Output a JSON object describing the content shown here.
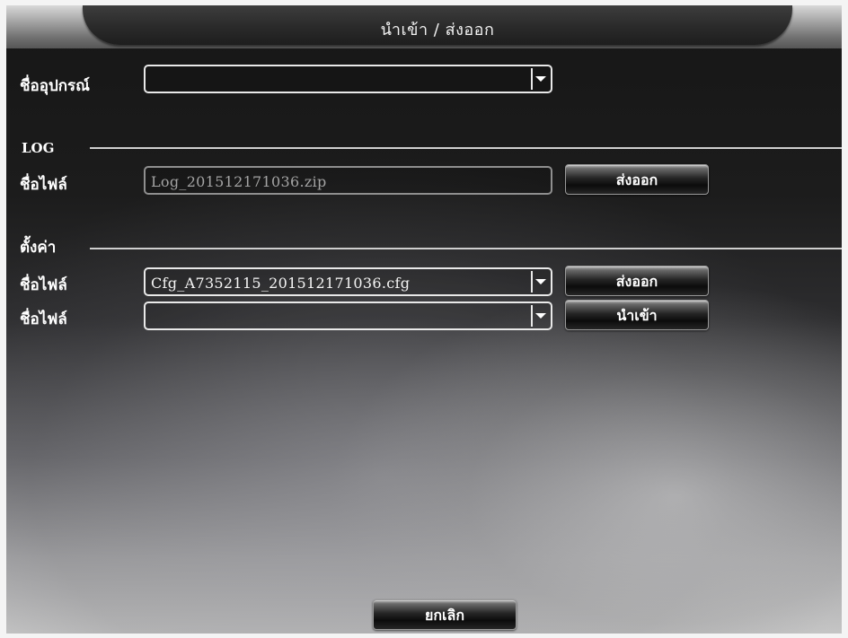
{
  "window": {
    "title": "นำเข้า / ส่งออก"
  },
  "device": {
    "label": "ชื่ออุปกรณ์",
    "value": ""
  },
  "log_section": {
    "heading": "LOG",
    "file_label": "ชื่อไฟล์",
    "file_value": "Log_201512171036.zip",
    "export_label": "ส่งออก"
  },
  "config_section": {
    "heading": "ตั้งค่า",
    "export_row": {
      "file_label": "ชื่อไฟล์",
      "file_value": "Cfg_A7352115_201512171036.cfg",
      "button_label": "ส่งออก"
    },
    "import_row": {
      "file_label": "ชื่อไฟล์",
      "file_value": "",
      "button_label": "นำเข้า"
    }
  },
  "footer": {
    "cancel_label": "ยกเลิก"
  }
}
